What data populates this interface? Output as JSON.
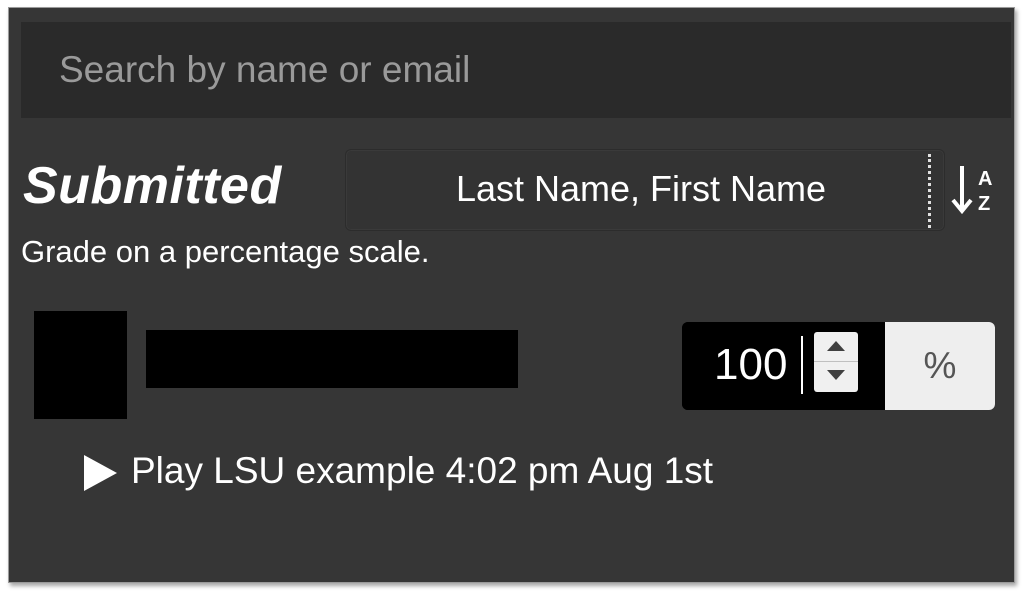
{
  "search": {
    "placeholder": "Search by name or email"
  },
  "section": {
    "title": "Submitted",
    "subtitle": "Grade on a percentage scale."
  },
  "sort": {
    "selected_label": "Last Name, First Name",
    "icon": "sort-alpha-icon"
  },
  "student": {
    "avatar": "redacted",
    "name": "redacted"
  },
  "grade": {
    "value": "100",
    "unit": "%"
  },
  "submission": {
    "label": "Play LSU example 4:02 pm Aug 1st"
  },
  "colors": {
    "panel_background": "#363636",
    "search_background": "#2a2a2a",
    "text": "#ffffff",
    "placeholder": "#9a9a9a",
    "addon_background": "#eeeeee"
  }
}
